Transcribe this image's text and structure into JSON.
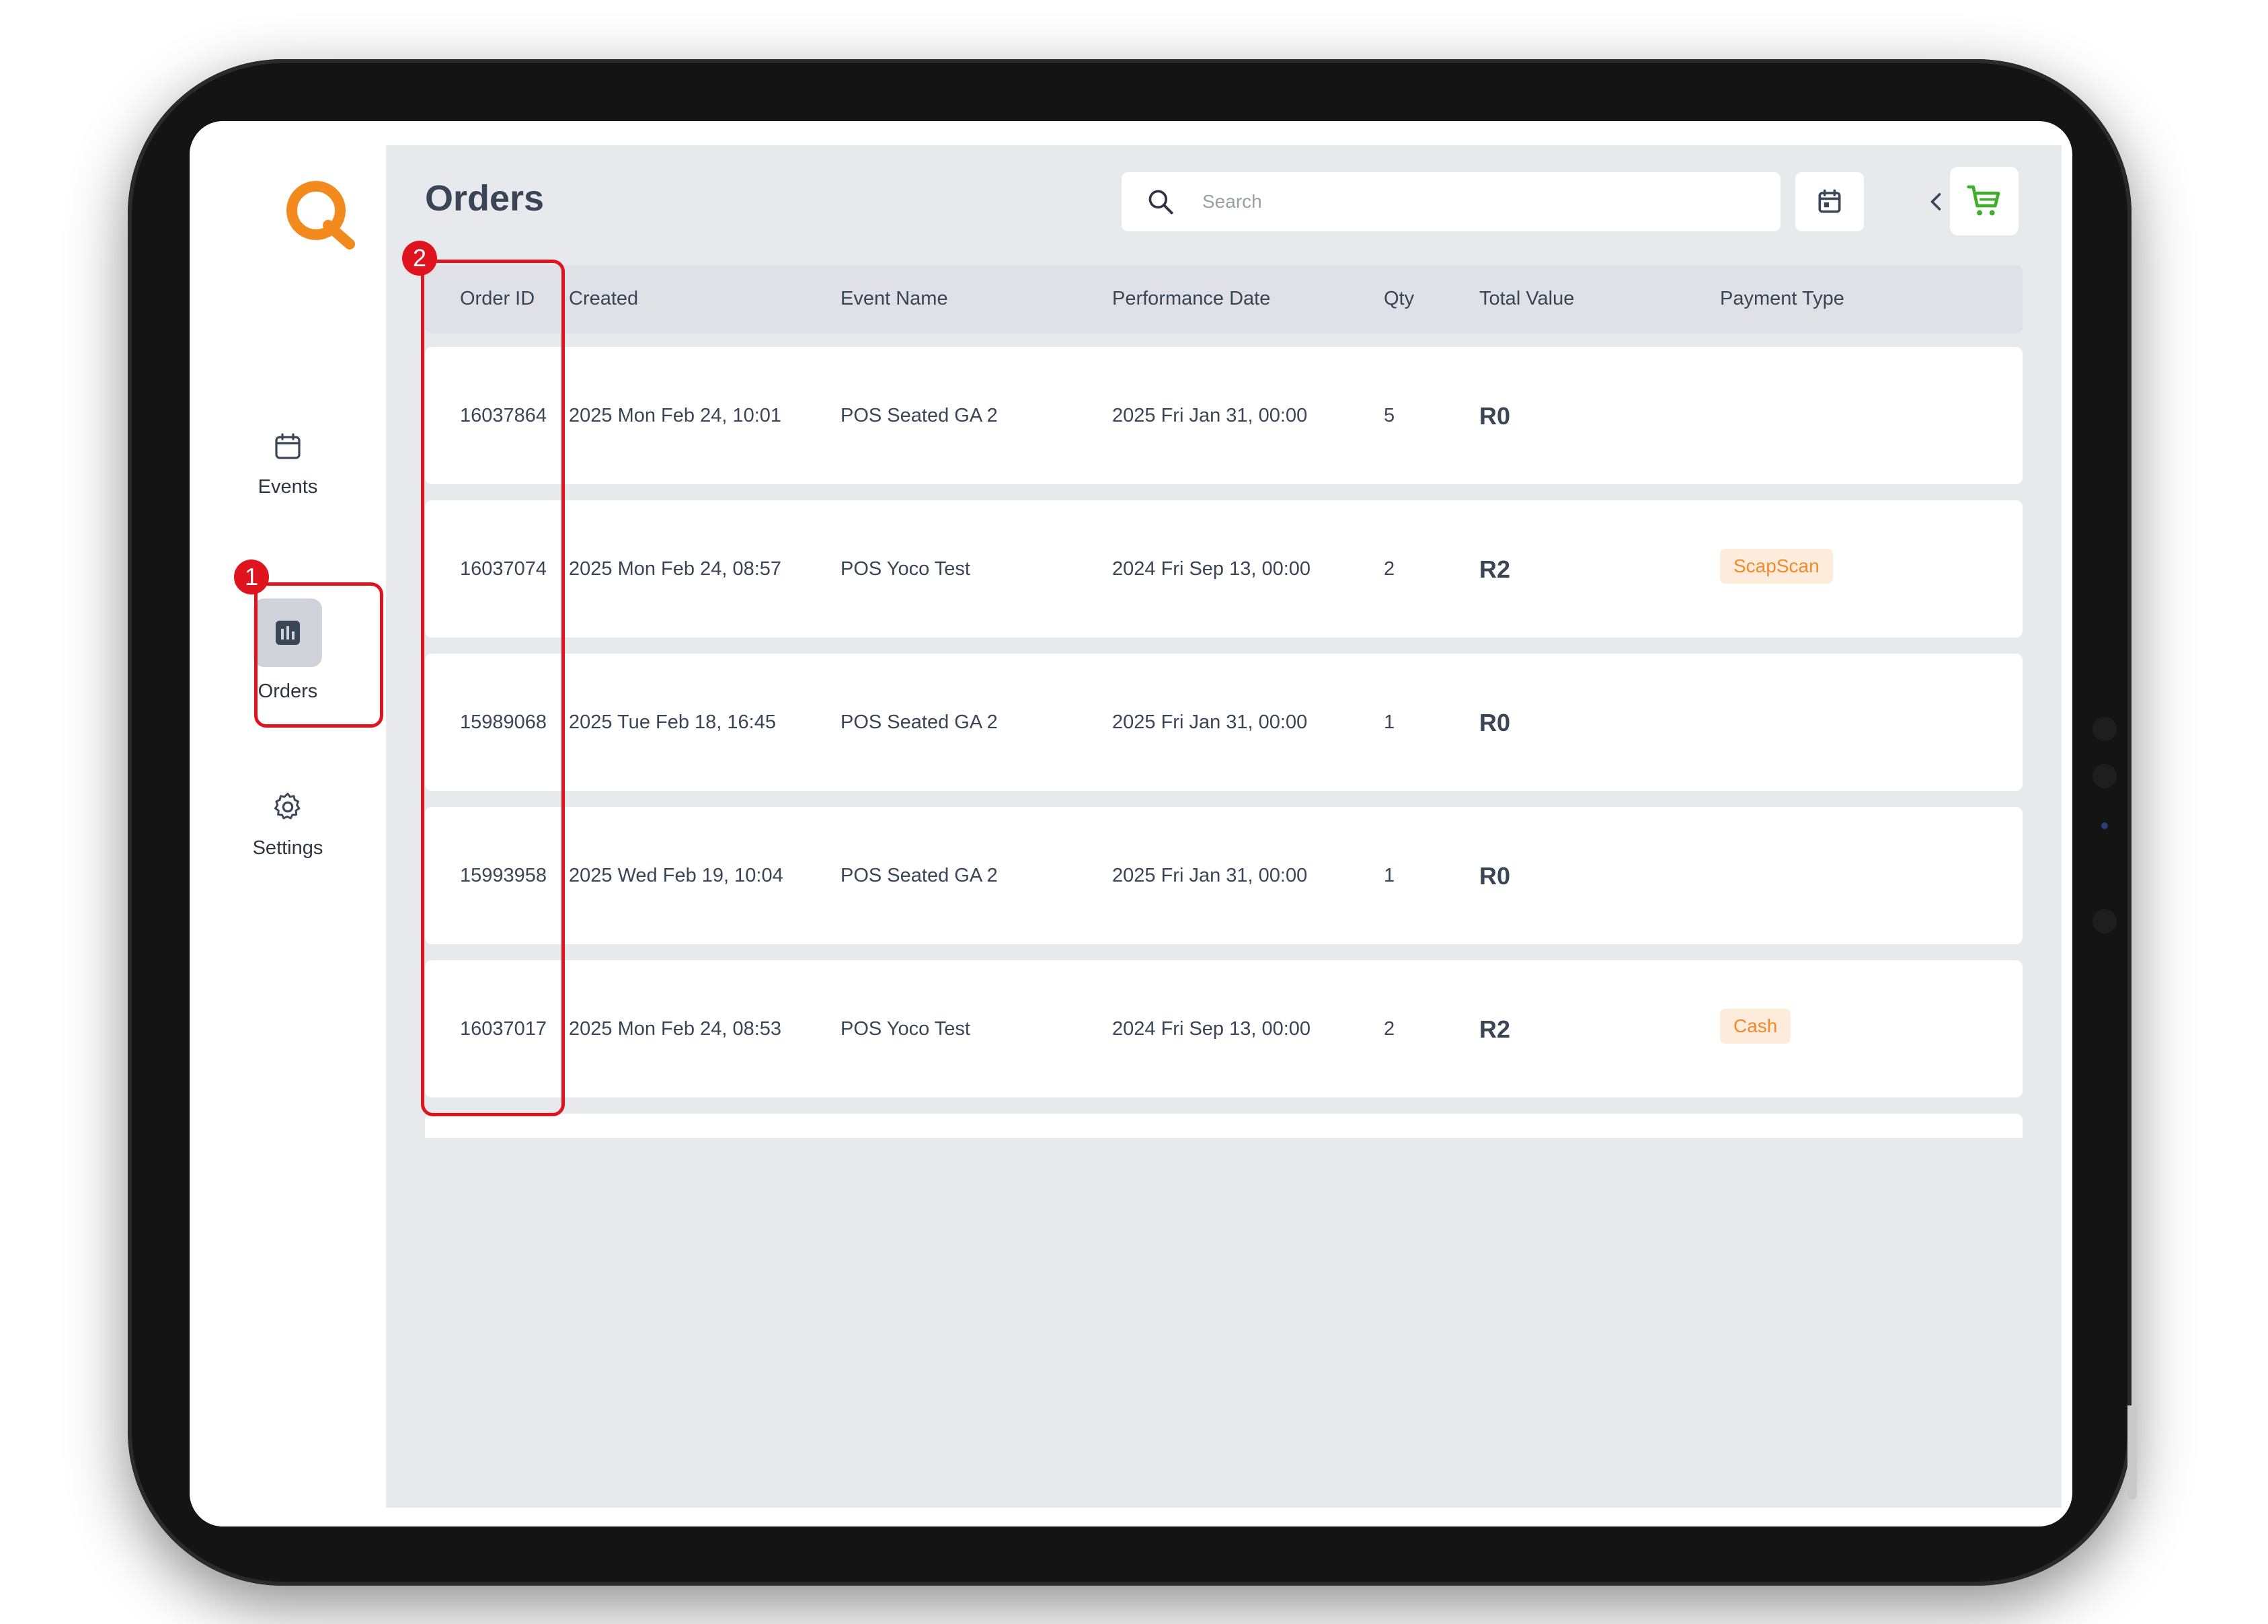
{
  "app": {
    "logo_letter": "Q",
    "brand_color": "#f28a1d"
  },
  "sidebar": {
    "items": [
      {
        "label": "Events",
        "icon": "calendar-icon",
        "active": false
      },
      {
        "label": "Orders",
        "icon": "bar-chart-icon",
        "active": true
      },
      {
        "label": "Settings",
        "icon": "gear-icon",
        "active": false
      }
    ]
  },
  "header": {
    "title": "Orders",
    "search_placeholder": "Search",
    "search_value": ""
  },
  "table": {
    "columns": [
      "Order ID",
      "Created",
      "Event Name",
      "Performance Date",
      "Qty",
      "Total Value",
      "Payment Type"
    ],
    "rows": [
      {
        "order_id": "16037864",
        "created": "2025 Mon Feb 24, 10:01",
        "event_name": "POS Seated GA 2",
        "performance_date": "2025 Fri Jan 31, 00:00",
        "qty": "5",
        "total": "R0",
        "payment_type": ""
      },
      {
        "order_id": "16037074",
        "created": "2025 Mon Feb 24, 08:57",
        "event_name": "POS Yoco Test",
        "performance_date": "2024 Fri Sep 13, 00:00",
        "qty": "2",
        "total": "R2",
        "payment_type": "ScapScan"
      },
      {
        "order_id": "15989068",
        "created": "2025 Tue Feb 18, 16:45",
        "event_name": "POS Seated GA 2",
        "performance_date": "2025 Fri Jan 31, 00:00",
        "qty": "1",
        "total": "R0",
        "payment_type": ""
      },
      {
        "order_id": "15993958",
        "created": "2025 Wed Feb 19, 10:04",
        "event_name": "POS Seated GA 2",
        "performance_date": "2025 Fri Jan 31, 00:00",
        "qty": "1",
        "total": "R0",
        "payment_type": ""
      },
      {
        "order_id": "16037017",
        "created": "2025 Mon Feb 24, 08:53",
        "event_name": "POS Yoco Test",
        "performance_date": "2024 Fri Sep 13, 00:00",
        "qty": "2",
        "total": "R2",
        "payment_type": "Cash"
      }
    ]
  },
  "annotations": {
    "marker_1": "1",
    "marker_2": "2",
    "highlight_color": "#e0141e"
  },
  "colors": {
    "badge_bg": "#fdecdc",
    "badge_text": "#f08a2c",
    "cart_green": "#3fae2a"
  }
}
